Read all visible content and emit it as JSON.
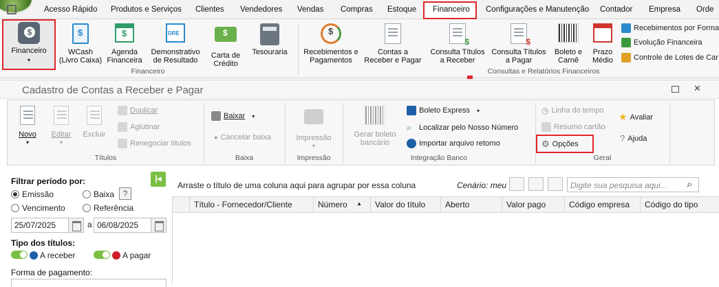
{
  "menu": [
    "Acesso Rápido",
    "Produtos e Serviços",
    "Clientes",
    "Vendedores",
    "Vendas",
    "Compras",
    "Estoque",
    "Financeiro",
    "Configurações e Manutenção",
    "Contador",
    "Empresa",
    "Orde"
  ],
  "ribbon": {
    "buttons": [
      {
        "label": "Financeiro",
        "icon": "finance-wallet-icon"
      },
      {
        "label": "WCash (Livro Caixa)",
        "icon": "cashbook-icon"
      },
      {
        "label": "Agenda Financeira",
        "icon": "calendar-money-icon"
      },
      {
        "label": "Demonstrativo de Resultado",
        "icon": "dre-report-icon"
      },
      {
        "label": "Carta de Crédito",
        "icon": "credit-card-money-icon"
      },
      {
        "label": "Tesouraria",
        "icon": "calculator-icon"
      },
      {
        "label": "Recebimentos e Pagamentos",
        "icon": "money-cycle-icon"
      },
      {
        "label": "Contas a Receber e Pagar",
        "icon": "document-money-icon"
      },
      {
        "label": "Consulta Títulos a Receber",
        "icon": "document-green-icon"
      },
      {
        "label": "Consulta Títulos a Pagar",
        "icon": "document-red-icon"
      },
      {
        "label": "Boleto e Carnê",
        "icon": "barcode-icon"
      },
      {
        "label": "Prazo Médio",
        "icon": "calendar-red-icon"
      }
    ],
    "small_items": [
      "Recebimentos por Forma",
      "Evolução Financeira",
      "Controle de Lotes de Car"
    ],
    "group_financeiro": "Financeiro",
    "group_consultas": "Consultas e Relatórios Financeiros"
  },
  "window": {
    "title": "Cadastro de Contas a Receber e Pagar",
    "toolbar": {
      "novo": "Novo",
      "editar": "Editar",
      "excluir": "Excluir",
      "duplicar": "Duplicar",
      "aglutinar": "Aglutinar",
      "renegociar": "Renegociar títulos",
      "baixar": "Baixar",
      "cancelar_baixa": "Cancelar baixa",
      "impressao": "Impressão",
      "gerar_boleto": "Gerar boleto bancário",
      "boleto_express": "Boleto Express",
      "localizar": "Localizar pelo Nosso Número",
      "importar": "Importar arquivo retorno",
      "linha_tempo": "Linha do tempo",
      "resumo_cartao": "Resumo cartão",
      "opcoes": "Opções",
      "avaliar": "Avaliar",
      "ajuda": "Ajuda"
    },
    "groups": {
      "titulos": "Títulos",
      "baixa": "Baixa",
      "impressao": "Impressão",
      "integracao": "Integração Banco",
      "geral": "Geral"
    }
  },
  "filter": {
    "periodo_label": "Filtrar período por:",
    "options": [
      "Emissão",
      "Baixa",
      "Vencimento",
      "Referência"
    ],
    "selected": "Emissão",
    "help": "?",
    "date_from": "25/07/2025",
    "date_sep": "a",
    "date_to": "06/08/2025",
    "tipo_label": "Tipo dos títulos:",
    "receber": "A receber",
    "pagar": "A pagar",
    "forma_label": "Forma de pagamento:"
  },
  "grid": {
    "group_hint": "Arraste o título de uma coluna aqui para agrupar por essa coluna",
    "cenario": "Cenário: meu",
    "search_placeholder": "Digite sua pesquisa aqui...",
    "columns": [
      "Título - Fornecedor/Cliente",
      "Número",
      "Valor do título",
      "Aberto",
      "Valor pago",
      "Código empresa",
      "Código do tipo"
    ],
    "sort_indicator": "▲"
  },
  "colors": {
    "highlight": "#e0242b",
    "receber_dot": "#1f5fa8",
    "pagar_dot": "#cc1f2a",
    "toggle": "#7bbf43"
  }
}
